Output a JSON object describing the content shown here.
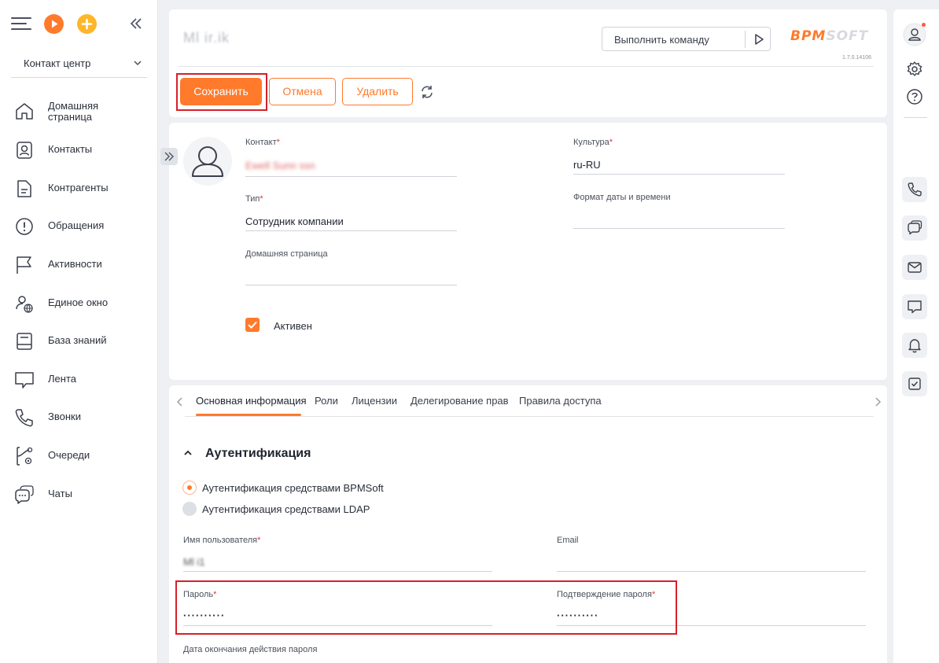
{
  "app": {
    "brand_main": "BPM",
    "brand_soft": "SOFT",
    "version": "1.7.0.14106"
  },
  "sidebar": {
    "workplace": "Контакт центр",
    "items": [
      {
        "label": "Домашняя страница",
        "icon": "home-icon"
      },
      {
        "label": "Контакты",
        "icon": "contact-icon"
      },
      {
        "label": "Контрагенты",
        "icon": "document-icon"
      },
      {
        "label": "Обращения",
        "icon": "alert-icon"
      },
      {
        "label": "Активности",
        "icon": "flag-icon"
      },
      {
        "label": "Единое окно",
        "icon": "user-globe-icon"
      },
      {
        "label": "База знаний",
        "icon": "book-icon"
      },
      {
        "label": "Лента",
        "icon": "feed-icon"
      },
      {
        "label": "Звонки",
        "icon": "phone-icon"
      },
      {
        "label": "Очереди",
        "icon": "queue-icon"
      },
      {
        "label": "Чаты",
        "icon": "chat-icon"
      }
    ]
  },
  "header": {
    "title": "Ml    ir.ik",
    "command_placeholder": "Выполнить команду",
    "save_label": "Сохранить",
    "cancel_label": "Отмена",
    "delete_label": "Удалить"
  },
  "profile": {
    "contact_label": "Контакт",
    "contact_value": "Ewell  Sunn  ssn",
    "type_label": "Тип",
    "type_value": "Сотрудник компании",
    "homepage_label": "Домашняя страница",
    "homepage_value": "",
    "culture_label": "Культура",
    "culture_value": "ru-RU",
    "datetime_label": "Формат даты и времени",
    "datetime_value": "",
    "active_label": "Активен",
    "active": true
  },
  "tabs": [
    "Основная информация",
    "Роли",
    "Лицензии",
    "Делегирование прав",
    "Правила доступа"
  ],
  "auth": {
    "section_title": "Аутентификация",
    "option_bpmsoft": "Аутентификация средствами BPMSoft",
    "option_ldap": "Аутентификация средствами LDAP",
    "selected": "bpmsoft",
    "username_label": "Имя пользователя",
    "username_value": "Ml    i1",
    "email_label": "Email",
    "email_value": "",
    "password_label": "Пароль",
    "password_value": "··········",
    "confirm_label": "Подтверждение пароля",
    "confirm_value": "··········",
    "expiry_label": "Дата окончания действия пароля"
  },
  "colors": {
    "accent": "#ff7a2b",
    "highlight": "#d6202a",
    "yellow": "#ffb62a"
  }
}
